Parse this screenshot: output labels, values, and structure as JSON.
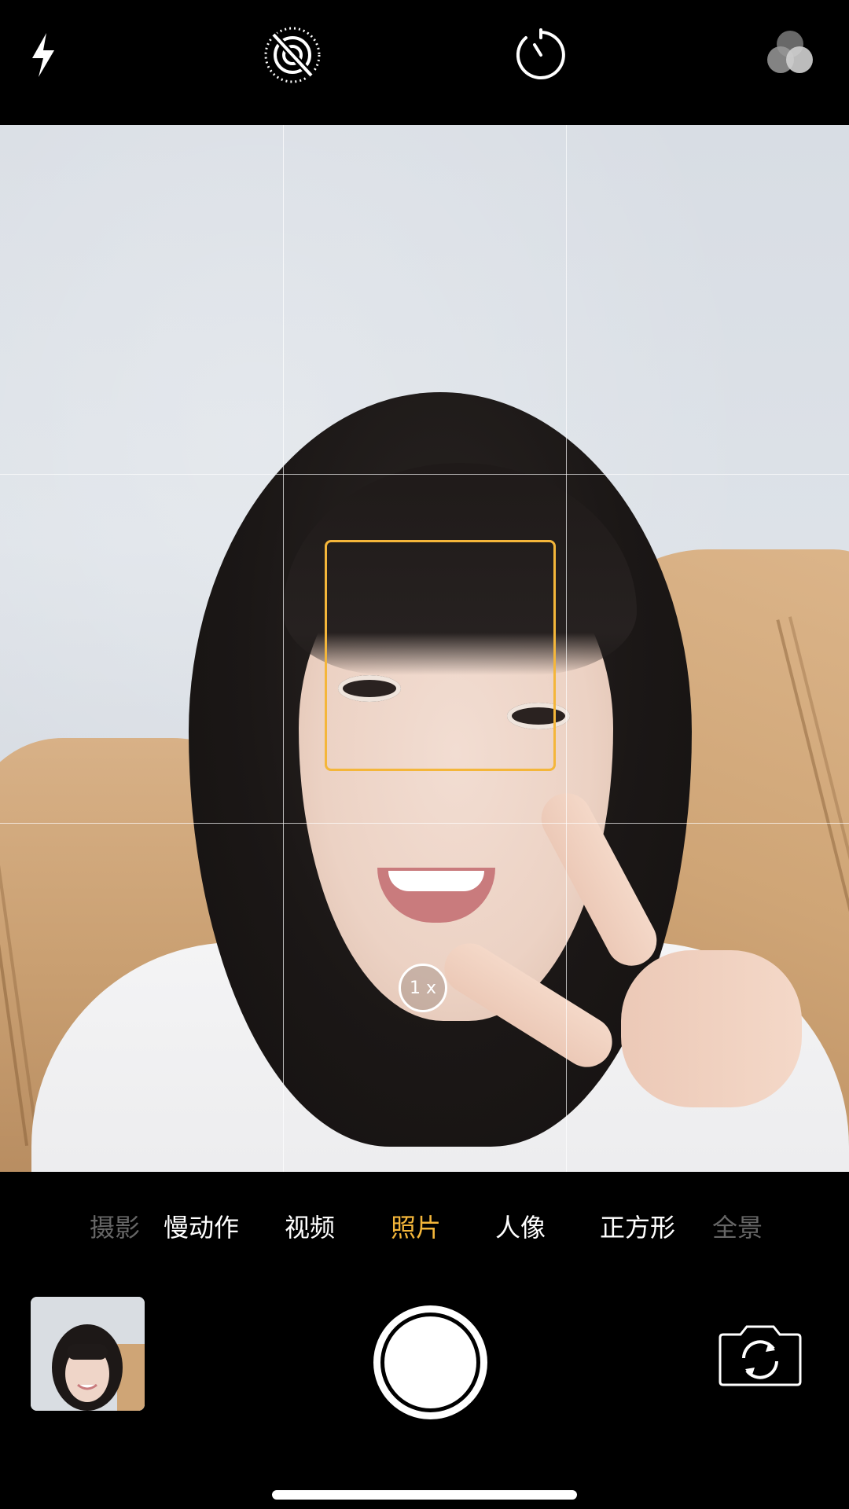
{
  "top_controls": {
    "flash_icon": "lightning-bolt",
    "live_photo_icon": "live-photo-off",
    "timer_icon": "timer",
    "filters_icon": "filters-circles"
  },
  "viewfinder": {
    "zoom_label": "1 x",
    "focus_box_color": "#f4b63a",
    "grid": "3x3"
  },
  "modes": [
    {
      "label": "摄影",
      "state": "faded"
    },
    {
      "label": "慢动作",
      "state": "normal"
    },
    {
      "label": "视频",
      "state": "normal"
    },
    {
      "label": "照片",
      "state": "active"
    },
    {
      "label": "人像",
      "state": "normal"
    },
    {
      "label": "正方形",
      "state": "normal"
    },
    {
      "label": "全景",
      "state": "faded"
    }
  ],
  "bottom_controls": {
    "thumbnail": "last-photo-thumbnail",
    "shutter": "shutter-button",
    "flip_icon": "camera-flip"
  },
  "colors": {
    "accent": "#f4b63a",
    "bar_background": "#000000"
  }
}
